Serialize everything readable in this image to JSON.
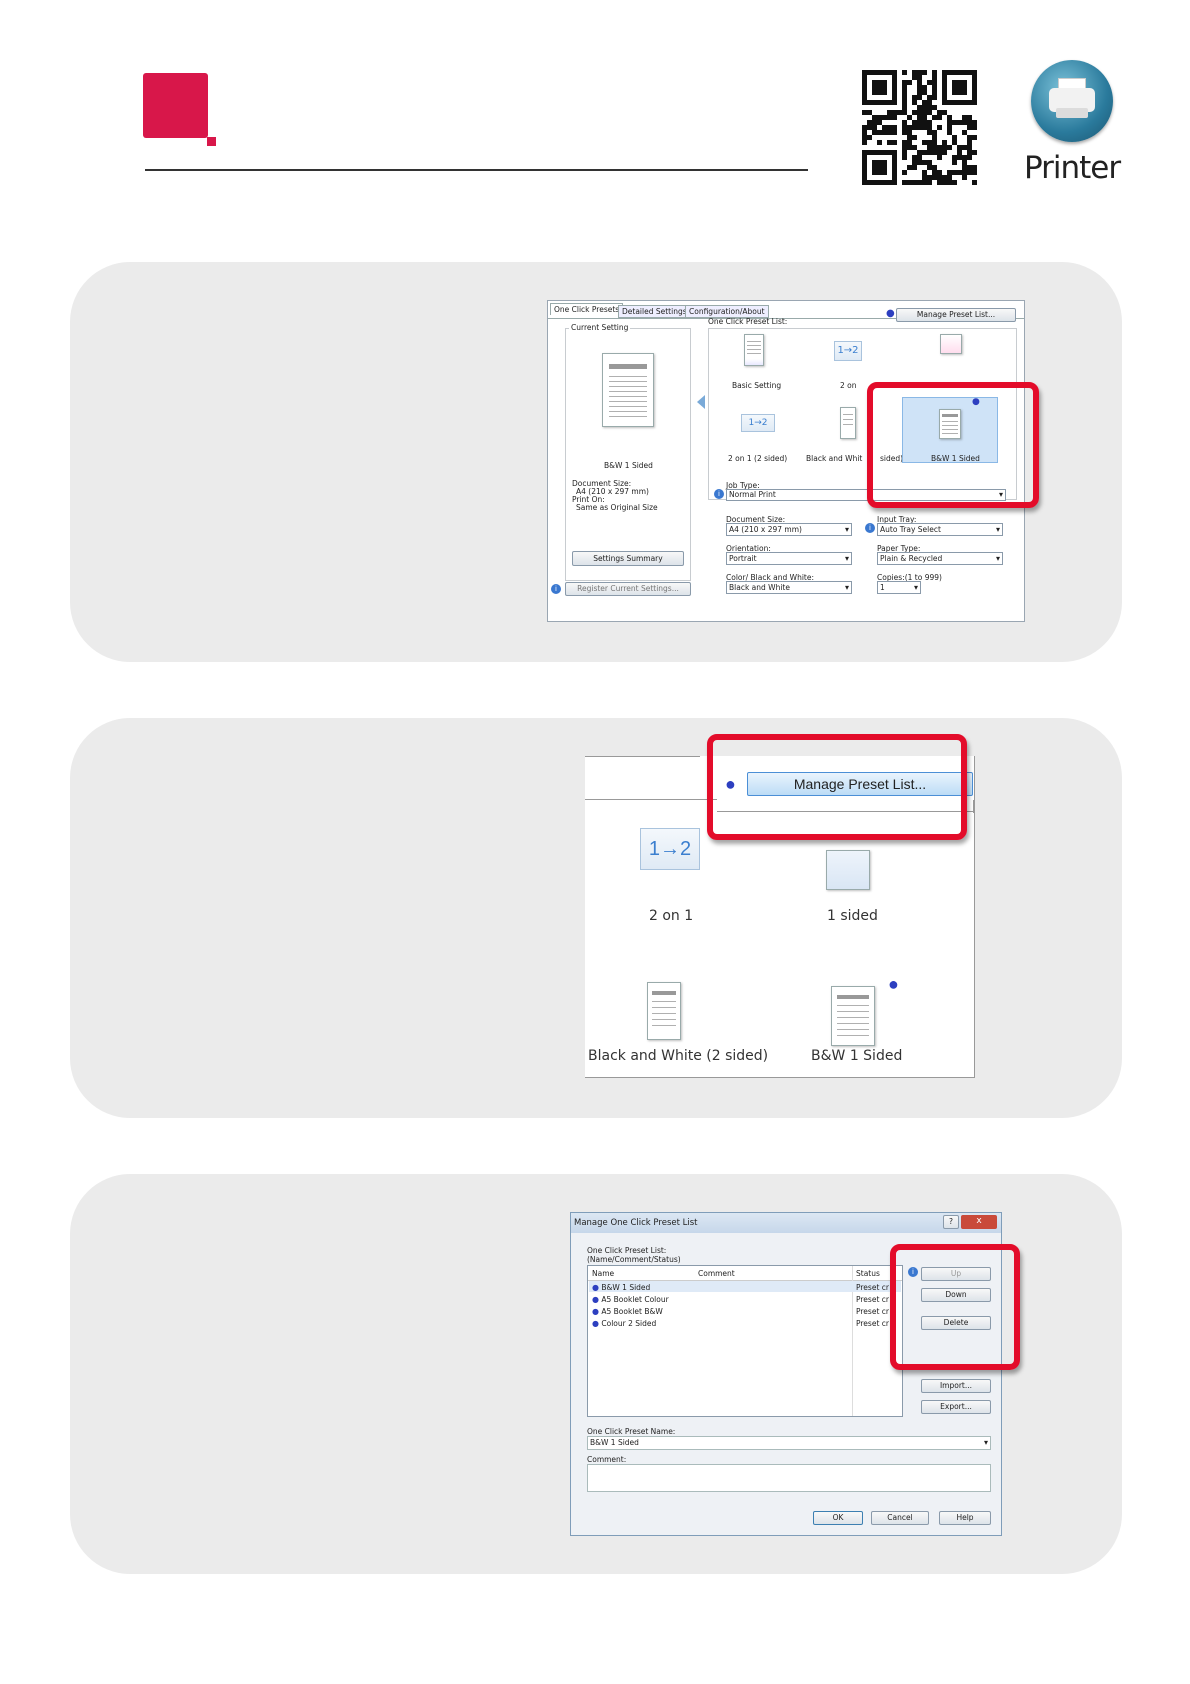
{
  "header": {
    "printer_label": "Printer"
  },
  "panel1": {
    "tabs": [
      "One Click Presets",
      "Detailed Settings",
      "Configuration/About"
    ],
    "manage_button": "Manage Preset List...",
    "preset_list_label": "One Click Preset List:",
    "current_setting_label": "Current Setting",
    "current_preset_name": "B&W 1 Sided",
    "document_size_label": "Document Size:",
    "document_size_value": "A4 (210 x 297 mm)",
    "print_on_label": "Print On:",
    "print_on_value": "Same as Original Size",
    "settings_summary_button": "Settings Summary",
    "register_button": "Register Current Settings...",
    "presets": [
      "Basic Setting",
      "2 on",
      "2 on 1 (2 sided)",
      "Black and Whit",
      "sided)",
      "B&W 1 Sided"
    ],
    "tile_2on1": "1→2",
    "job_type_label": "Job Type:",
    "job_type_value": "Normal Print",
    "doc_size_label": "Document Size:",
    "doc_size_value": "A4 (210 x 297 mm)",
    "input_tray_label": "Input Tray:",
    "input_tray_value": "Auto Tray Select",
    "orientation_label": "Orientation:",
    "orientation_value": "Portrait",
    "paper_type_label": "Paper Type:",
    "paper_type_value": "Plain & Recycled",
    "color_label": "Color/ Black and White:",
    "color_value": "Black and White",
    "copies_label": "Copies:(1 to 999)",
    "copies_value": "1"
  },
  "panel2": {
    "manage_button": "Manage Preset List...",
    "tile_2on1": "1→2",
    "presets": [
      "2 on 1",
      "1 sided",
      "Black and White (2 sided)",
      "B&W 1 Sided"
    ]
  },
  "panel3": {
    "dialog_title": "Manage One Click Preset List",
    "help_glyph": "?",
    "close_glyph": "x",
    "list_label": "One Click Preset List:",
    "list_sub_label": "(Name/Comment/Status)",
    "columns": [
      "Name",
      "Comment",
      "Status"
    ],
    "rows": [
      {
        "name": "B&W 1 Sided",
        "status": "Preset cr"
      },
      {
        "name": "A5 Booklet Colour",
        "status": "Preset cr"
      },
      {
        "name": "A5 Booklet B&W",
        "status": "Preset cr"
      },
      {
        "name": "Colour 2 Sided",
        "status": "Preset cr"
      }
    ],
    "buttons": {
      "up": "Up",
      "down": "Down",
      "delete": "Delete",
      "import": "Import...",
      "export": "Export..."
    },
    "name_label": "One Click Preset Name:",
    "name_value": "B&W 1 Sided",
    "comment_label": "Comment:",
    "ok": "OK",
    "cancel": "Cancel",
    "help": "Help"
  },
  "colors": {
    "brand_red": "#d8174a",
    "highlight_red": "#e30c2a",
    "panel_grey": "#ebebeb"
  }
}
